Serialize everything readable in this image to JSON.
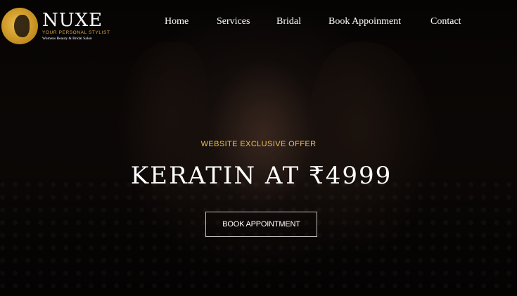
{
  "brand": {
    "name": "NUXE",
    "tagline": "YOUR PERSONAL STYLIST",
    "subtitle": "Womens Beauty & Bridal Salon",
    "logo_icon": "woman-profile-logo-icon",
    "accent_color": "#e1a83a"
  },
  "nav": {
    "items": [
      {
        "label": "Home"
      },
      {
        "label": "Services"
      },
      {
        "label": "Bridal"
      },
      {
        "label": "Book Appoinment"
      },
      {
        "label": "Contact"
      }
    ]
  },
  "hero": {
    "eyebrow": "WEBSITE EXCLUSIVE OFFER",
    "headline": "KERATIN AT ₹4999",
    "cta_label": "BOOK APPOINTMENT",
    "eyebrow_color": "#f2c04a"
  }
}
